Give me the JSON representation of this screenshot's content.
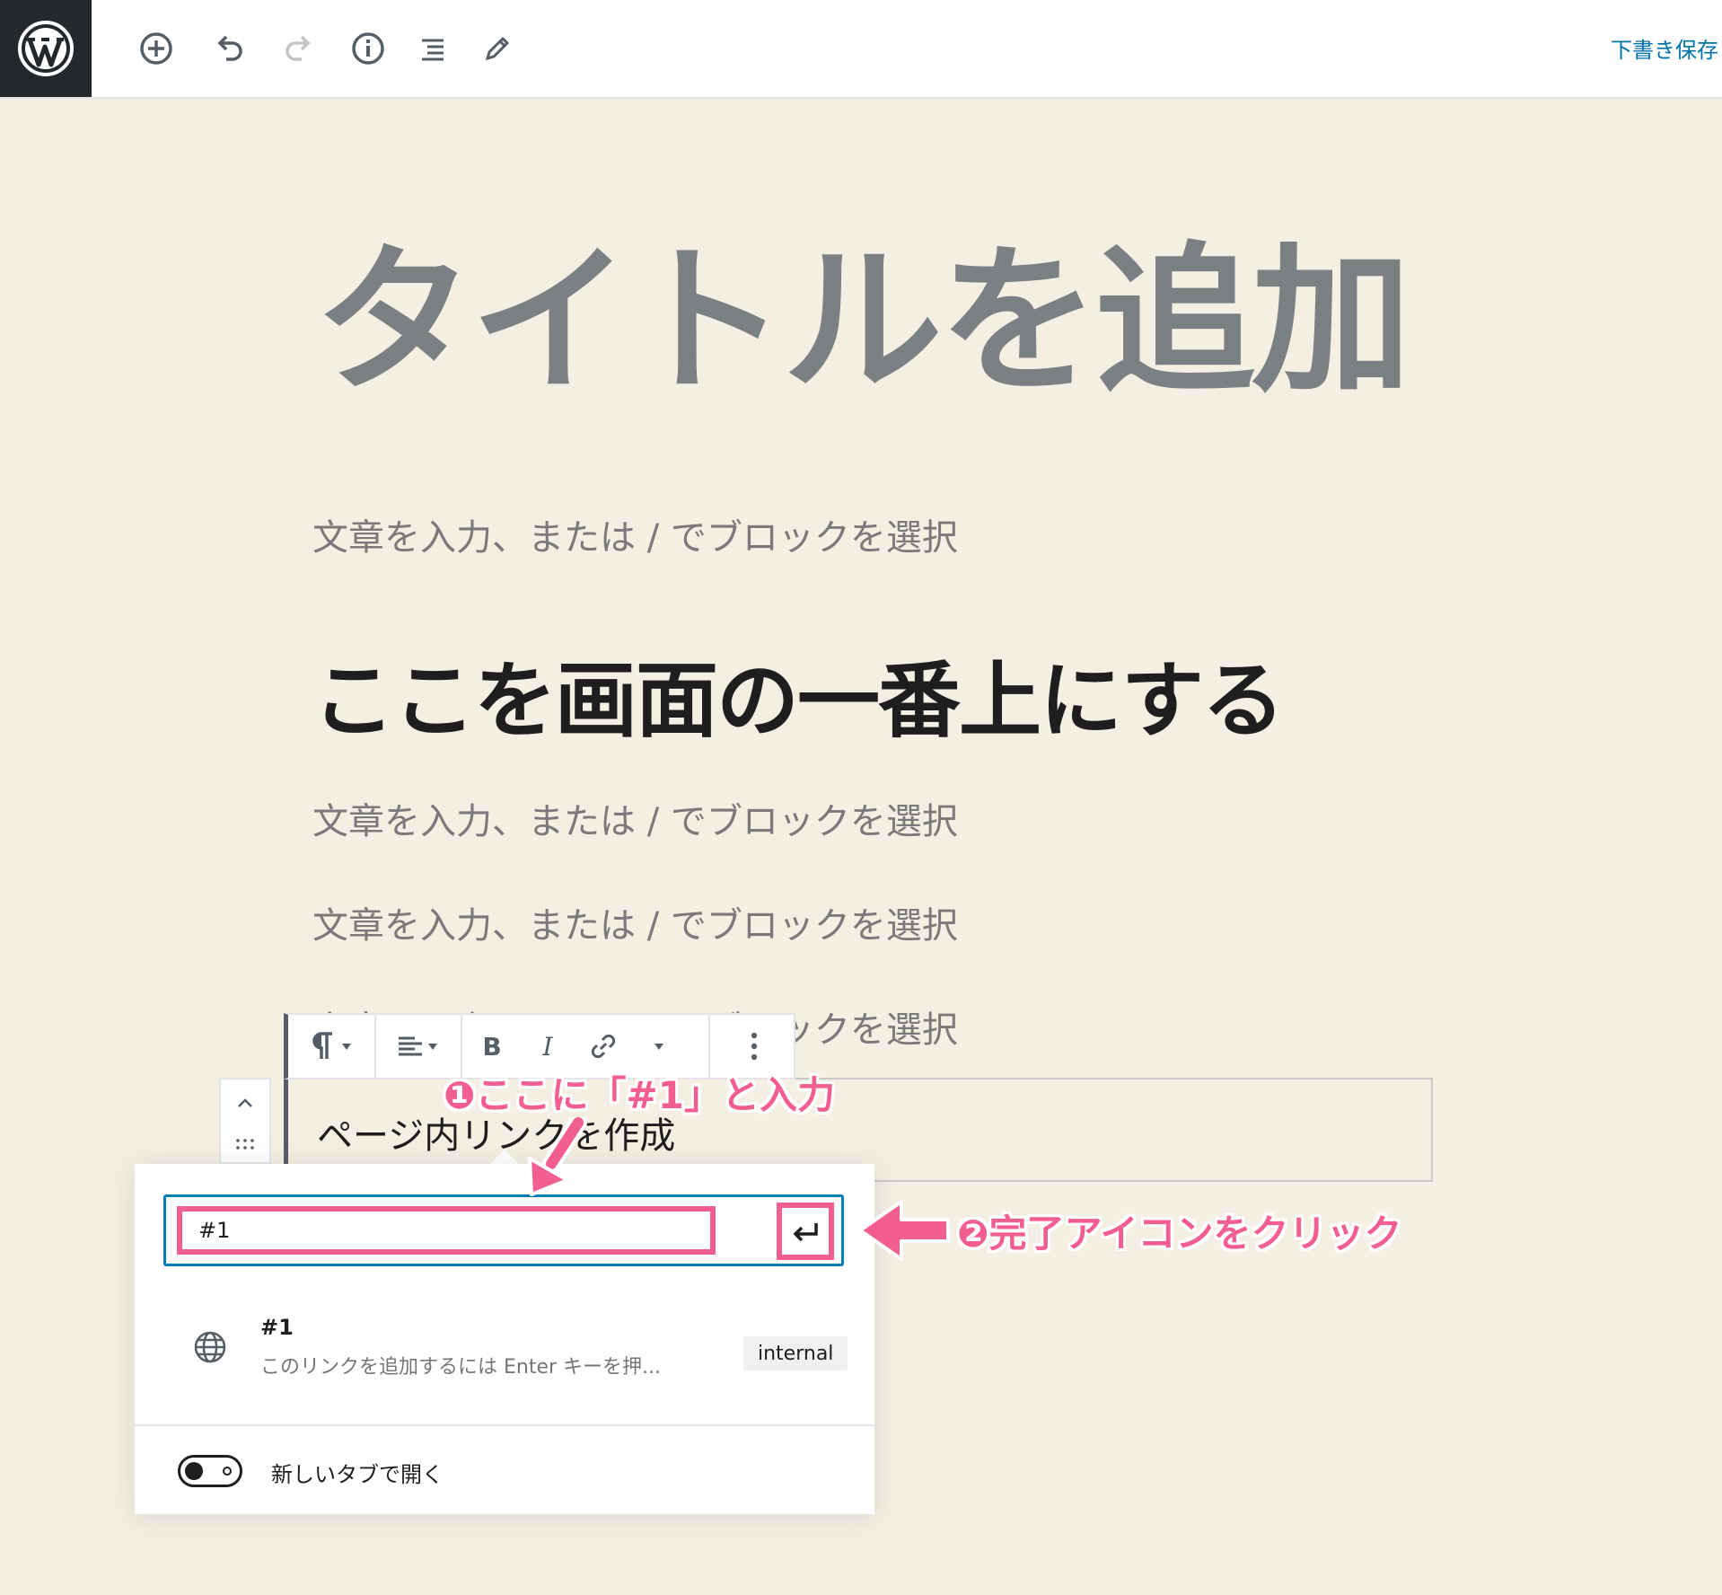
{
  "toolbar": {
    "add_icon": "plus-circle-icon",
    "undo_icon": "undo-icon",
    "redo_icon": "redo-icon",
    "info_icon": "info-icon",
    "outline_icon": "list-icon",
    "tools_icon": "pencil-icon",
    "save_draft": "下書き保存"
  },
  "editor": {
    "title_placeholder": "タイトルを追加",
    "paragraph_placeholder": "文章を入力、または / でブロックを選択",
    "heading": "ここを画面の一番上にする",
    "paragraph_placeholder_2": "文章を入力、または / でブロックを選択",
    "paragraph_placeholder_3": "文章を入力、または / でブロックを選択",
    "paragraph_placeholder_4": "文章を入力、または / でブロックを選択",
    "selected_block_text": "ページ内リンクを作成"
  },
  "block_toolbar": {
    "paragraph_icon": "pilcrow-icon",
    "align_icon": "align-left-icon",
    "bold_label": "B",
    "italic_label": "I",
    "link_icon": "link-icon",
    "more_icon": "more-vertical-icon"
  },
  "link_popover": {
    "url_value": "#1",
    "submit_icon": "enter-icon",
    "suggestion": {
      "title": "#1",
      "description": "このリンクを追加するには Enter キーを押...",
      "badge": "internal",
      "icon": "globe-icon"
    },
    "new_tab_label": "新しいタブで開く",
    "new_tab_enabled": false
  },
  "annotations": {
    "step1": "❶ここに「#1」と入力",
    "step2": "❷完了アイコンをクリック",
    "color": "#f25f8f"
  },
  "colors": {
    "background": "#f4efe3",
    "accent": "#007cba",
    "dark": "#23282d"
  }
}
